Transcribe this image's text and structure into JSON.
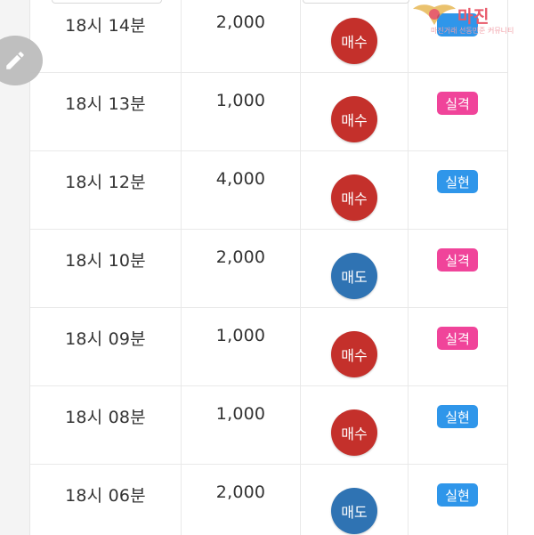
{
  "colors": {
    "buy": "#c4302b",
    "sell": "#2f73b3",
    "fail": "#f0449a",
    "realized": "#2f96ea"
  },
  "rows": [
    {
      "time": "18시 14분",
      "qty": "2,000",
      "side": "매수",
      "side_type": "buy",
      "result": "",
      "result_type": "realized"
    },
    {
      "time": "18시 13분",
      "qty": "1,000",
      "side": "매수",
      "side_type": "buy",
      "result": "실격",
      "result_type": "fail"
    },
    {
      "time": "18시 12분",
      "qty": "4,000",
      "side": "매수",
      "side_type": "buy",
      "result": "실현",
      "result_type": "realized"
    },
    {
      "time": "18시 10분",
      "qty": "2,000",
      "side": "매도",
      "side_type": "sell",
      "result": "실격",
      "result_type": "fail"
    },
    {
      "time": "18시 09분",
      "qty": "1,000",
      "side": "매수",
      "side_type": "buy",
      "result": "실격",
      "result_type": "fail"
    },
    {
      "time": "18시 08분",
      "qty": "1,000",
      "side": "매수",
      "side_type": "buy",
      "result": "실현",
      "result_type": "realized"
    },
    {
      "time": "18시 06분",
      "qty": "2,000",
      "side": "매도",
      "side_type": "sell",
      "result": "실현",
      "result_type": "realized"
    }
  ],
  "watermark": {
    "brand": "마진",
    "tagline": "마진거래 선동민준 커뮤니티"
  },
  "icons": {
    "edit_fab": "pencil-icon",
    "watermark_logo": "winged-emblem-icon"
  }
}
